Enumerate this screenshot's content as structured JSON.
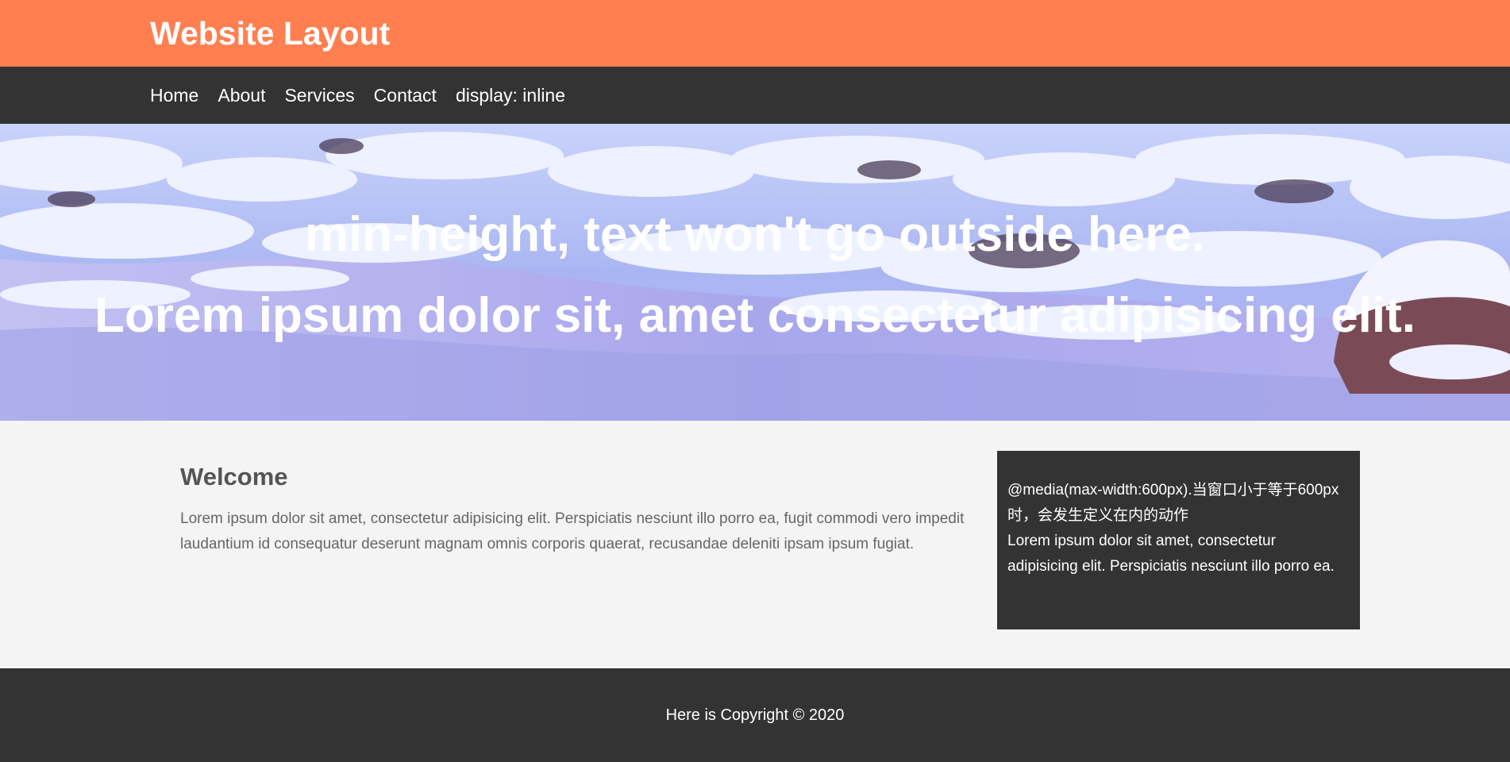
{
  "header": {
    "brand": "Website Layout"
  },
  "nav": {
    "items": [
      {
        "label": "Home"
      },
      {
        "label": "About"
      },
      {
        "label": "Services"
      },
      {
        "label": "Contact"
      },
      {
        "label": "display: inline"
      }
    ]
  },
  "showcase": {
    "line1": "min-height, text won't go outside here.",
    "line2": "Lorem ipsum dolor sit, amet consectetur adipisicing elit."
  },
  "main": {
    "heading": "Welcome",
    "paragraph": "Lorem ipsum dolor sit amet, consectetur adipisicing elit. Perspiciatis nesciunt illo porro ea, fugit commodi vero impedit laudantium id consequatur deserunt magnam omnis corporis quaerat, recusandae deleniti ipsam ipsum fugiat."
  },
  "sidebar": {
    "line1": "@media(max-width:600px).当窗口小于等于600px时，会发生定义在内的动作",
    "line2": "Lorem ipsum dolor sit amet, consectetur adipisicing elit. Perspiciatis nesciunt illo porro ea."
  },
  "footer": {
    "copyright": "Here is Copyright © 2020"
  },
  "colors": {
    "header_bg": "#ff7f50",
    "nav_bg": "#333333",
    "page_bg": "#f4f4f4",
    "heading_text": "#555555",
    "body_text": "#666666"
  },
  "showcase_image": "snowy-river-photo"
}
